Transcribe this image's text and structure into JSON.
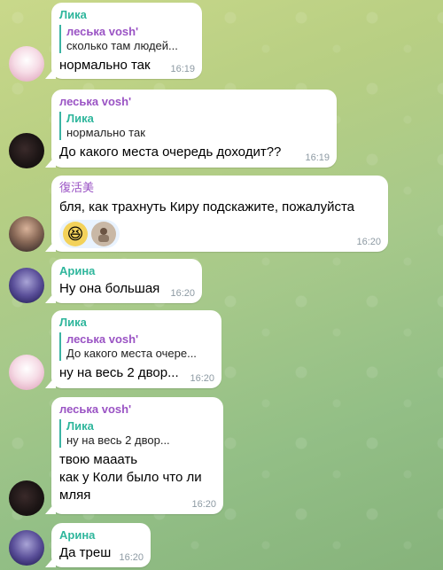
{
  "colors": {
    "name_lika": "#2fb69c",
    "name_lesya": "#9a53c4",
    "name_fuk": "#9a53c4",
    "name_arina": "#2fb69c",
    "bubble_bg": "#ffffff",
    "time": "#8d9aa3"
  },
  "messages": [
    {
      "sender": "Лика",
      "reply_name": "леська vosh'",
      "reply_text": "сколько там людей...",
      "text": "нормально так",
      "time": "16:19"
    },
    {
      "sender": "леська vosh'",
      "reply_name": "Лика",
      "reply_text": "нормально так",
      "text": "До какого места очередь доходит??",
      "time": "16:19"
    },
    {
      "sender": "復活美",
      "text": "бля, как трахнуть Киру подскажите, пожалуйста",
      "reaction_icons": [
        "grinning-face-icon",
        "sticker-photo-icon"
      ],
      "time": "16:20"
    },
    {
      "sender": "Арина",
      "text": "Ну она большая",
      "time": "16:20"
    },
    {
      "sender": "Лика",
      "reply_name": "леська vosh'",
      "reply_text": "До какого места очере...",
      "text": "ну на весь 2 двор...",
      "time": "16:20"
    },
    {
      "sender": "леська vosh'",
      "reply_name": "Лика",
      "reply_text": "ну на весь 2 двор...",
      "text_lines": [
        "твою мааать",
        "как у Коли было что ли",
        "мляя"
      ],
      "time": "16:20"
    },
    {
      "sender": "Арина",
      "text": "Да треш",
      "time": "16:20"
    }
  ]
}
